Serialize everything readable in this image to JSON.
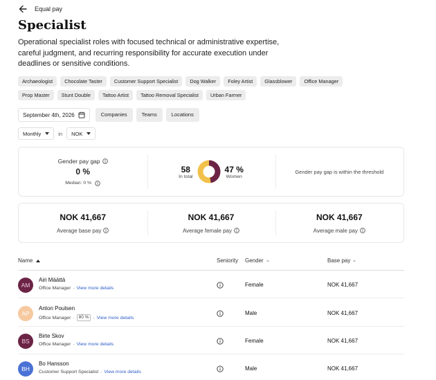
{
  "header": {
    "back_label": "Equal pay"
  },
  "page": {
    "title": "Specialist",
    "description": "Operational specialist roles with focused technical or administrative expertise, careful judgment, and recurring responsibility for accurate execution under deadlines or sensitive conditions."
  },
  "roles": [
    "Archaeologist",
    "Chocolate Taster",
    "Customer Support Specialist",
    "Dog Walker",
    "Foley Artist",
    "Glassblower",
    "Office Manager",
    "Prop Master",
    "Stunt Double",
    "Tattoo Artist",
    "Tattoo Removal Specialist",
    "Urban Farmer"
  ],
  "filters": {
    "date": "September 4th, 2026",
    "companies": "Companies",
    "teams": "Teams",
    "locations": "Locations"
  },
  "controls": {
    "period": "Monthly",
    "in_label": "in",
    "currency": "NOK"
  },
  "summary": {
    "gap_label": "Gender pay gap",
    "gap_value": "0 %",
    "median": "Median: 0 %",
    "total_count": "58",
    "total_label": "In total",
    "women_pct": "47 %",
    "women_label": "Women",
    "women_fraction": 0.47,
    "threshold_text": "Gender pay gap is within the threshold",
    "colors": {
      "women": "#6b2445",
      "men": "#f1c14b"
    }
  },
  "pay": {
    "base_value": "NOK 41,667",
    "base_label": "Average base pay",
    "female_value": "NOK 41,667",
    "female_label": "Average female pay",
    "male_value": "NOK 41,667",
    "male_label": "Average male pay"
  },
  "table": {
    "headers": {
      "name": "Name",
      "seniority": "Seniority",
      "gender": "Gender",
      "base_pay": "Base pay"
    },
    "rows": [
      {
        "initials": "AM",
        "name": "Airi Määttä",
        "role": "Office Manager",
        "badge": "",
        "link": "View more details",
        "gender": "Female",
        "base_pay": "NOK 41,667",
        "avatar_bg": "#6b2445",
        "avatar_fg": "#f0c8d8"
      },
      {
        "initials": "AP",
        "name": "Anton Poulsen",
        "role": "Office Manager",
        "badge": "80 %",
        "link": "View more details",
        "gender": "Male",
        "base_pay": "NOK 41,667",
        "avatar_bg": "#f6c9a0",
        "avatar_fg": "#ffffff"
      },
      {
        "initials": "BS",
        "name": "Birte Skov",
        "role": "Office Manager",
        "badge": "",
        "link": "View more details",
        "gender": "Female",
        "base_pay": "NOK 41,667",
        "avatar_bg": "#6b2445",
        "avatar_fg": "#f0c8d8"
      },
      {
        "initials": "BH",
        "name": "Bo Hansson",
        "role": "Customer Support Specialist",
        "badge": "",
        "link": "View more details",
        "gender": "Male",
        "base_pay": "NOK 41,667",
        "avatar_bg": "#4a72d6",
        "avatar_fg": "#ffffff"
      }
    ]
  }
}
